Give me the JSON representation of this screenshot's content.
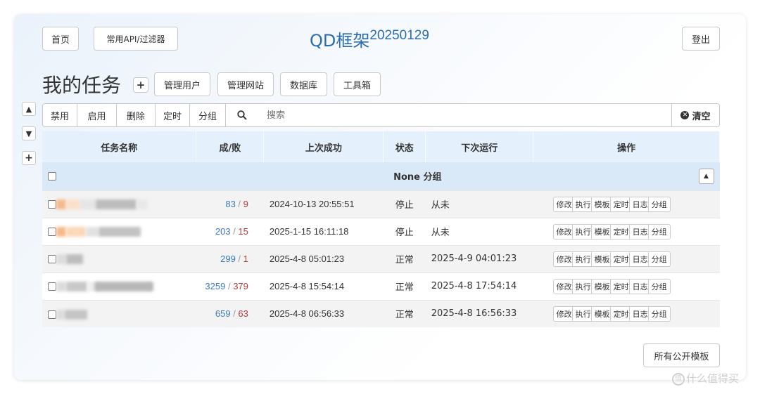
{
  "header": {
    "home_label": "首页",
    "api_label": "常用API/过滤器",
    "title": "QD框架",
    "version": "20250129",
    "logout_label": "登出"
  },
  "tasks_header": {
    "title": "我的任务",
    "add_label": "+",
    "buttons": [
      "管理用户",
      "管理网站",
      "数据库",
      "工具箱"
    ]
  },
  "side_controls": {
    "up": "▲",
    "down": "▼",
    "plus": "+"
  },
  "toolbar": {
    "disable_label": "禁用",
    "enable_label": "启用",
    "delete_label": "删除",
    "timer_label": "定时",
    "group_label": "分组",
    "search_icon": "search-icon",
    "search_placeholder": "搜索",
    "clear_label": "清空"
  },
  "table": {
    "columns": [
      "任务名称",
      "成/败",
      "上次成功",
      "状态",
      "下次运行",
      "操作"
    ],
    "group_label": "None 分组",
    "operations": [
      "修改",
      "执行",
      "模板",
      "定时",
      "日志",
      "分组"
    ],
    "rows": [
      {
        "success": "83",
        "fail": "9",
        "last_success": "2024-10-13 20:55:51",
        "status": "停止",
        "next_run": "从未"
      },
      {
        "success": "203",
        "fail": "15",
        "last_success": "2025-1-15 16:11:18",
        "status": "停止",
        "next_run": "从未"
      },
      {
        "success": "299",
        "fail": "1",
        "last_success": "2025-4-8 05:01:23",
        "status": "正常",
        "next_run": "2025-4-9 04:01:23"
      },
      {
        "success": "3259",
        "fail": "379",
        "last_success": "2025-4-8 15:54:14",
        "status": "正常",
        "next_run": "2025-4-8 17:54:14"
      },
      {
        "success": "659",
        "fail": "63",
        "last_success": "2025-4-8 06:56:33",
        "status": "正常",
        "next_run": "2025-4-8 16:56:33"
      }
    ]
  },
  "footer": {
    "public_templates_label": "所有公开模板",
    "watermark": "什么值得买",
    "watermark_logo": "值"
  },
  "colors": {
    "title_blue": "#2a6db3",
    "success_blue": "#3a7abf",
    "fail_red": "#b33b3b",
    "header_bg": "#e4f0fc",
    "group_bg": "#d9e9f8"
  }
}
